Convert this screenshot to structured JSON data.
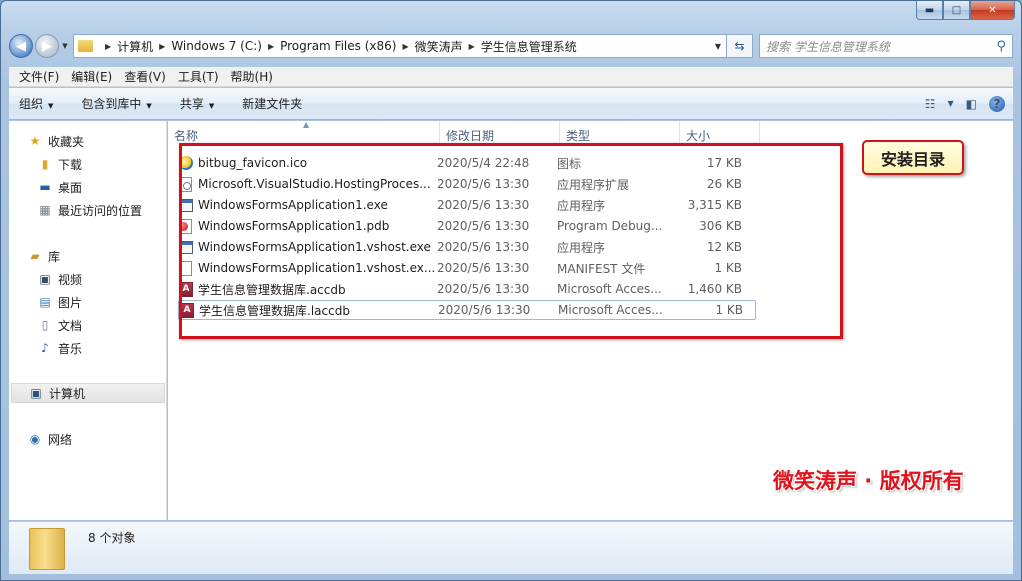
{
  "window": {
    "caption": {
      "minimize": "▬",
      "maximize": "□",
      "close": "✕"
    }
  },
  "address": {
    "crumbs": [
      "计算机",
      "Windows 7 (C:)",
      "Program Files (x86)",
      "微笑涛声",
      "学生信息管理系统"
    ],
    "search_placeholder": "搜索 学生信息管理系统"
  },
  "menu": [
    "文件(F)",
    "编辑(E)",
    "查看(V)",
    "工具(T)",
    "帮助(H)"
  ],
  "commands": {
    "organize": "组织",
    "include_library": "包含到库中",
    "share": "共享",
    "new_folder": "新建文件夹"
  },
  "nav": {
    "favorites": "收藏夹",
    "downloads": "下载",
    "desktop": "桌面",
    "recent": "最近访问的位置",
    "libraries": "库",
    "videos": "视频",
    "pictures": "图片",
    "documents": "文档",
    "music": "音乐",
    "computer": "计算机",
    "network": "网络"
  },
  "columns": {
    "name": "名称",
    "date": "修改日期",
    "type": "类型",
    "size": "大小"
  },
  "files": [
    {
      "name": "bitbug_favicon.ico",
      "date": "2020/5/4 22:48",
      "type": "图标",
      "size": "17 KB",
      "icon": "ico-icon"
    },
    {
      "name": "Microsoft.VisualStudio.HostingProces...",
      "date": "2020/5/6 13:30",
      "type": "应用程序扩展",
      "size": "26 KB",
      "icon": "dll-icon"
    },
    {
      "name": "WindowsFormsApplication1.exe",
      "date": "2020/5/6 13:30",
      "type": "应用程序",
      "size": "3,315 KB",
      "icon": "exe-icon"
    },
    {
      "name": "WindowsFormsApplication1.pdb",
      "date": "2020/5/6 13:30",
      "type": "Program Debug...",
      "size": "306 KB",
      "icon": "pdb-icon"
    },
    {
      "name": "WindowsFormsApplication1.vshost.exe",
      "date": "2020/5/6 13:30",
      "type": "应用程序",
      "size": "12 KB",
      "icon": "exe-icon"
    },
    {
      "name": "WindowsFormsApplication1.vshost.ex...",
      "date": "2020/5/6 13:30",
      "type": "MANIFEST 文件",
      "size": "1 KB",
      "icon": "blank-file-icon"
    },
    {
      "name": "学生信息管理数据库.accdb",
      "date": "2020/5/6 13:30",
      "type": "Microsoft Acces...",
      "size": "1,460 KB",
      "icon": "access-icon"
    },
    {
      "name": "学生信息管理数据库.laccdb",
      "date": "2020/5/6 13:30",
      "type": "Microsoft Acces...",
      "size": "1 KB",
      "icon": "access-lock-icon"
    }
  ],
  "annotation": {
    "callout": "安装目录",
    "watermark": "微笑涛声 · 版权所有"
  },
  "status": {
    "count": "8 个对象"
  },
  "colors": {
    "annotation_red": "#d1111b",
    "selection_border": "#9fb6d6"
  }
}
